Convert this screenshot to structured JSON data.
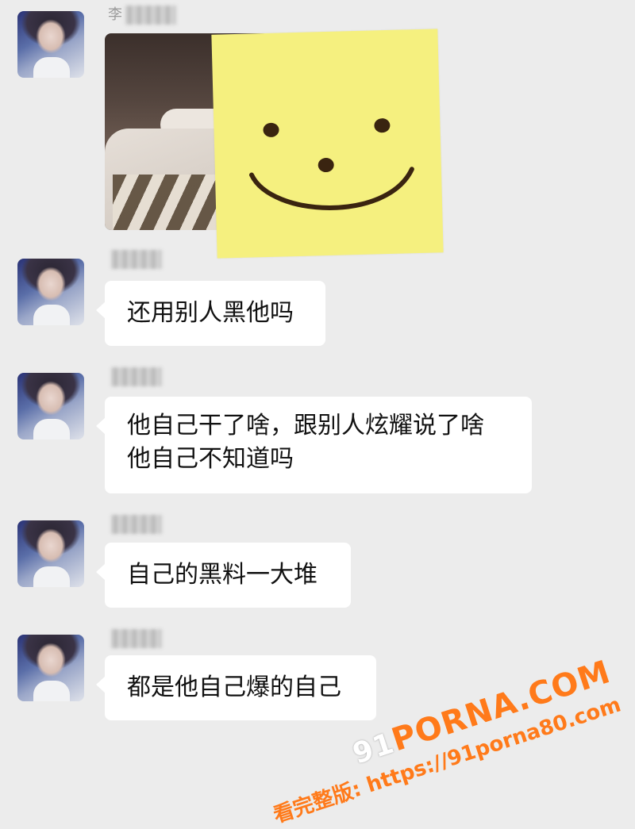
{
  "messages": [
    {
      "sender_name": "李",
      "type": "image"
    },
    {
      "sender_name": "",
      "text": "还用别人黑他吗"
    },
    {
      "sender_name": "",
      "text_line1": "他自己干了啥，跟别人炫耀说了啥",
      "text_line2": "他自己不知道吗"
    },
    {
      "sender_name": "",
      "text": "自己的黑料一大堆"
    },
    {
      "sender_name": "",
      "text": "都是他自己爆的自己"
    }
  ],
  "watermark": {
    "prefix": "91",
    "brand": "PORNA.COM",
    "line": "看完整版: https://91porna80.com"
  },
  "colors": {
    "background": "#ececec",
    "bubble": "#ffffff",
    "sticker": "#f5f07f",
    "sticker_ink": "#3a2410",
    "watermark": "#ff7a1a"
  }
}
